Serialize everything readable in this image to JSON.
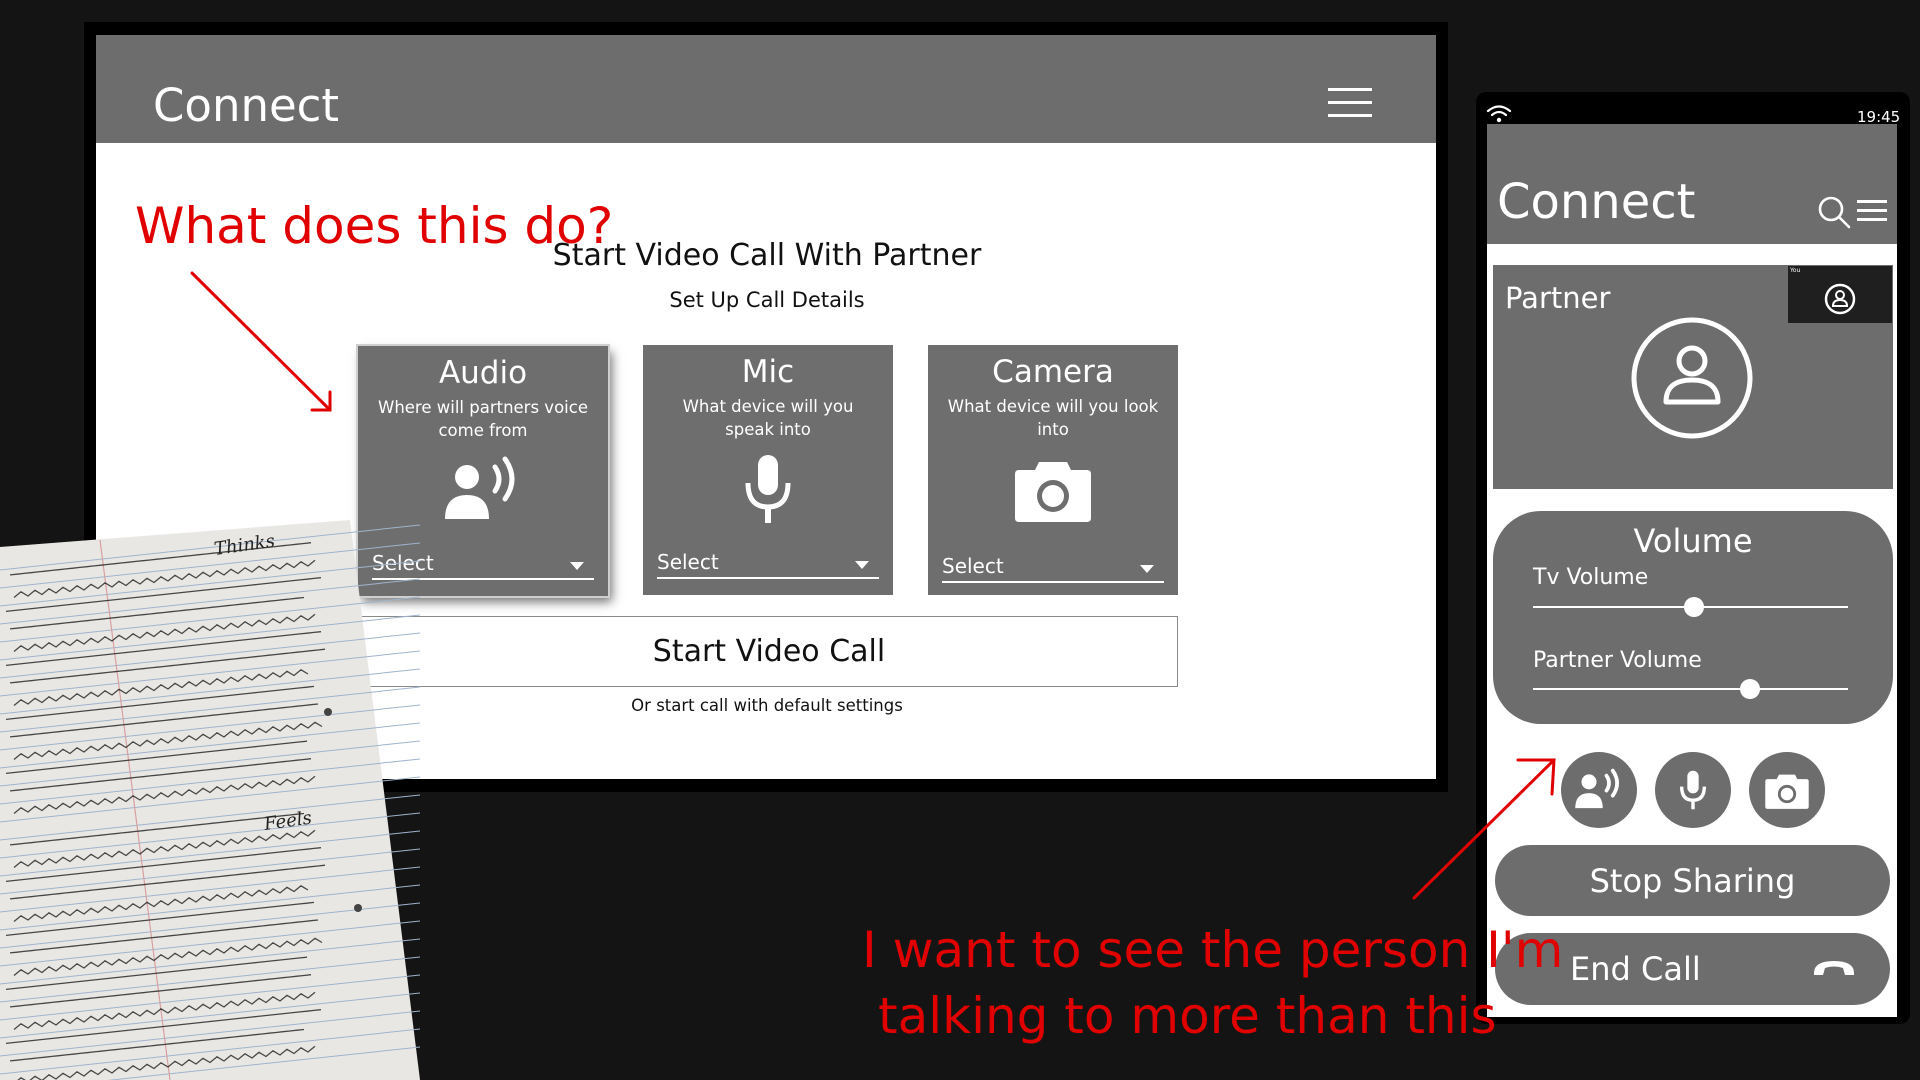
{
  "tv": {
    "app_title": "Connect",
    "heading": "Start Video Call With Partner",
    "subheading": "Set Up Call Details",
    "cards": [
      {
        "title": "Audio",
        "desc": "Where will partners voice come from",
        "select": "Select",
        "icon": "speaker-person-icon"
      },
      {
        "title": "Mic",
        "desc": "What device will you speak into",
        "select": "Select",
        "icon": "microphone-icon"
      },
      {
        "title": "Camera",
        "desc": "What device will you look into",
        "select": "Select",
        "icon": "camera-icon"
      }
    ],
    "start_button": "Start Video Call",
    "default_link": "Or start call with default settings"
  },
  "annotations": {
    "tv_note": "What does this do?",
    "phone_note_line1": "I want to see the person I'm",
    "phone_note_line2": "talking to more than this"
  },
  "phone": {
    "status_time": "19:45",
    "app_title": "Connect",
    "partner_label": "Partner",
    "self_label": "You",
    "volume_title": "Volume",
    "tv_volume_label": "Tv Volume",
    "tv_volume_level": 0.51,
    "partner_volume_label": "Partner Volume",
    "partner_volume_level": 0.69,
    "stop_sharing": "Stop Sharing",
    "end_call": "End Call"
  },
  "notes": {
    "headings": [
      "Thinks",
      "Feels"
    ]
  },
  "colors": {
    "panel_gray": "#6d6d6d",
    "annotation_red": "#e00000",
    "background": "#141414"
  }
}
